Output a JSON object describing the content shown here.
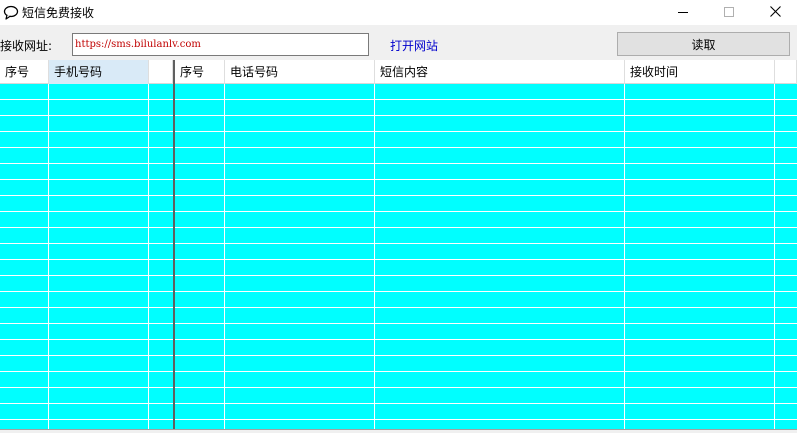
{
  "window": {
    "title": "短信免费接收",
    "controls": {
      "minimize": "minimize-icon",
      "maximize": "maximize-icon",
      "close": "close-icon"
    }
  },
  "toolbar": {
    "address_label": "接收网址:",
    "address_value": "https://sms.bilulanlv.com",
    "open_link": "打开网站",
    "read_button": "读取"
  },
  "left_grid": {
    "columns": [
      "序号",
      "手机号码",
      ""
    ],
    "selected_column": "手机号码"
  },
  "right_grid": {
    "columns": [
      "序号",
      "电话号码",
      "短信内容",
      "接收时间",
      ""
    ]
  },
  "colors": {
    "grid_background": "#00ffff",
    "link": "#0000cc",
    "url_text": "#c00000",
    "selected_header": "#d9eaf7"
  },
  "icons": {
    "app": "speech-bubble-icon"
  }
}
